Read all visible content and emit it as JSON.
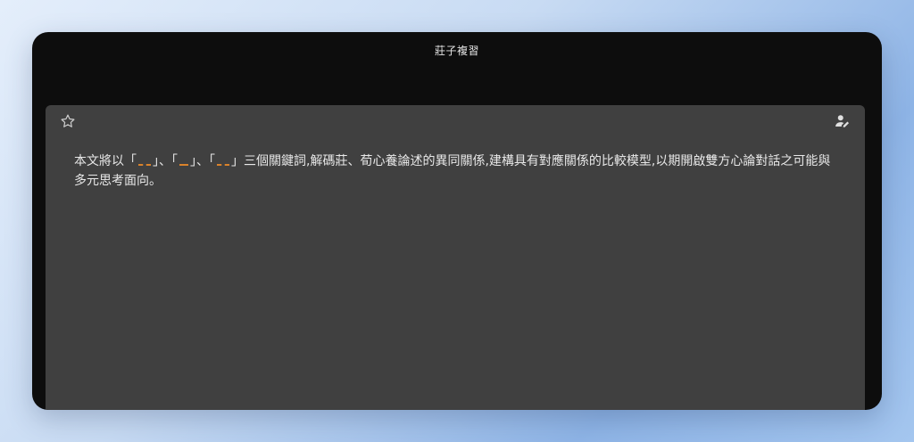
{
  "window": {
    "title": "莊子複習"
  },
  "card": {
    "abstract": {
      "part1": "本文將以「",
      "part2": "」、「",
      "part3": "」、「",
      "part4": "」三個關鍵詞,解碼莊、荀心養論述的異同關係,建構具有對應關係的比較模型,以期開啟雙方心論對話之可能與多元思考面向。"
    }
  },
  "icons": {
    "favorite": "star-outline-icon",
    "profile": "person-edit-icon"
  },
  "colors": {
    "blank_underline": "#d9822b",
    "card_bg": "#404040",
    "window_bg": "#0d0d0d"
  }
}
